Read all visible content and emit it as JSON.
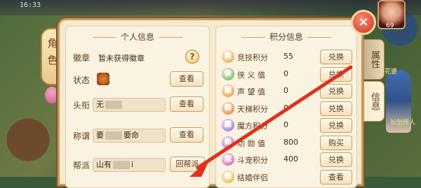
{
  "background": {
    "top_text": "16:33",
    "avatar_level": "69",
    "npc_label_1": "花婆",
    "npc_label_2": "长剑传人"
  },
  "window": {
    "close_icon": "×",
    "side_tabs": [
      "属性",
      "信息"
    ],
    "lantern_text": [
      "角",
      "色"
    ]
  },
  "personal": {
    "title": "个人信息",
    "badge_label": "徽章",
    "badge_value": "暂未获得徽章",
    "help_icon": "?",
    "status_label": "状态",
    "status_button": "查看",
    "title_label": "头衔",
    "title_value": "无",
    "title_button": "查看",
    "appellation_label": "称谓",
    "appellation_value_a": "要",
    "appellation_value_b": "要命",
    "appellation_button": "查看",
    "guild_label": "帮派",
    "guild_value_a": "山有",
    "guild_value_b": "i",
    "guild_button": "回帮派"
  },
  "scores": {
    "title": "积分信息",
    "items": [
      {
        "icon": "竞",
        "color": "#e0a028",
        "label": "竞技积分",
        "value": "55",
        "button": "兑换"
      },
      {
        "icon": "侠",
        "color": "#5aa84a",
        "label": "侠 义 值",
        "value": "0",
        "button": "兑换"
      },
      {
        "icon": "望",
        "color": "#e88a1c",
        "label": "声 望 值",
        "value": "0",
        "button": "兑换"
      },
      {
        "icon": "梯",
        "color": "#e86a1c",
        "label": "天梯积分",
        "value": "0",
        "button": "兑换"
      },
      {
        "icon": "魔",
        "color": "#8a5ad0",
        "label": "魔方积分",
        "value": "0",
        "button": "兑换"
      },
      {
        "icon": "勋",
        "color": "#a04ac8",
        "label": "功 勋 值",
        "value": "800",
        "button": "购买"
      },
      {
        "icon": "宠",
        "color": "#c94ab0",
        "label": "斗宠积分",
        "value": "400",
        "button": "兑换"
      },
      {
        "icon": "婚",
        "color": "#e0b020",
        "label": "结婚伴侣",
        "value": "",
        "button": "查看"
      }
    ]
  },
  "colors": {
    "panel_bg": "#f6e9cf",
    "accent_border": "#c79a5a",
    "annotation_arrow": "#e0301e"
  }
}
